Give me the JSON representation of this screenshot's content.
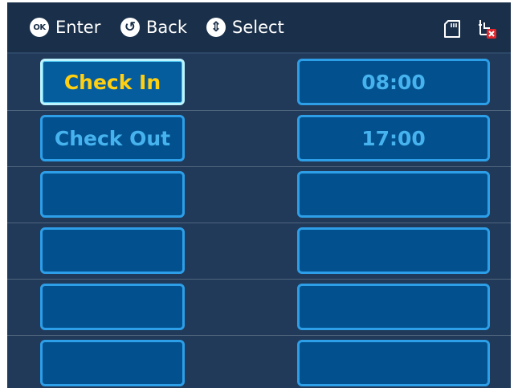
{
  "header": {
    "hints": [
      {
        "icon": "ok-icon",
        "glyph": "OK",
        "label": "Enter"
      },
      {
        "icon": "back-icon",
        "glyph": "↺",
        "label": "Back"
      },
      {
        "icon": "up-down-icon",
        "glyph": "⇕",
        "label": "Select"
      }
    ],
    "status_icons": [
      "sd-card-icon",
      "network-disconnected-icon"
    ]
  },
  "rows": [
    {
      "name": "Check In",
      "time": "08:00",
      "selected": true
    },
    {
      "name": "Check Out",
      "time": "17:00",
      "selected": false
    },
    {
      "name": "",
      "time": "",
      "selected": false
    },
    {
      "name": "",
      "time": "",
      "selected": false
    },
    {
      "name": "",
      "time": "",
      "selected": false
    },
    {
      "name": "",
      "time": "",
      "selected": false
    }
  ],
  "colors": {
    "background": "#213a59",
    "header": "#1a2f49",
    "button_fill": "#02518e",
    "button_border": "#2d9ee8",
    "text": "#46b3ee",
    "selected_text": "#ffcf10",
    "alert": "#e3262b"
  }
}
